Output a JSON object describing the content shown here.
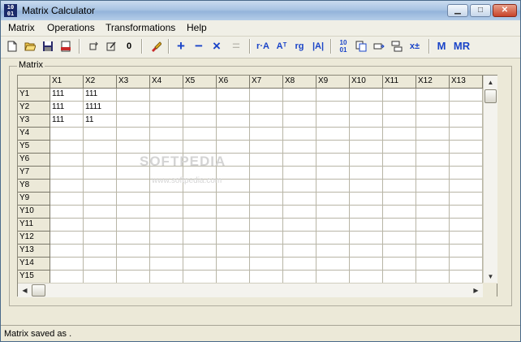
{
  "window": {
    "title": "Matrix Calculator",
    "app_icon_text": "10 01"
  },
  "menu": {
    "items": [
      "Matrix",
      "Operations",
      "Transformations",
      "Help"
    ]
  },
  "toolbar": {
    "groups": [
      [
        "new-file-icon",
        "open-folder-icon",
        "save-icon",
        "export-html-icon"
      ],
      [
        "rotate-icon",
        "edit-icon",
        "zero-icon"
      ],
      [
        "clear-brush-icon"
      ],
      [
        "plus-icon",
        "minus-icon",
        "multiply-icon",
        "equals-icon"
      ],
      [
        "row-op-icon",
        "transpose-icon",
        "rank-icon",
        "determinant-icon"
      ],
      [
        "binary-icon",
        "copy-icon",
        "move-icon",
        "swap-icon",
        "plus-minus-icon"
      ],
      [
        "m-icon",
        "mr-icon"
      ]
    ],
    "labels": {
      "zero": "0",
      "plus": "+",
      "minus": "−",
      "multiply": "×",
      "equals": "=",
      "row_op": "r·A",
      "transpose": "Aᵀ",
      "rank": "rg",
      "determinant": "|A|",
      "binary": "10\n01",
      "plus_minus": "x±",
      "m": "M",
      "mr": "MR"
    }
  },
  "matrix": {
    "group_label": "Matrix",
    "column_headers": [
      "X1",
      "X2",
      "X3",
      "X4",
      "X5",
      "X6",
      "X7",
      "X8",
      "X9",
      "X10",
      "X11",
      "X12",
      "X13"
    ],
    "row_headers": [
      "Y1",
      "Y2",
      "Y3",
      "Y4",
      "Y5",
      "Y6",
      "Y7",
      "Y8",
      "Y9",
      "Y10",
      "Y11",
      "Y12",
      "Y13",
      "Y14",
      "Y15"
    ],
    "cells": [
      [
        "111",
        "111",
        "",
        "",
        "",
        "",
        "",
        "",
        "",
        "",
        "",
        "",
        ""
      ],
      [
        "111",
        "1111",
        "",
        "",
        "",
        "",
        "",
        "",
        "",
        "",
        "",
        "",
        ""
      ],
      [
        "111",
        "11",
        "",
        "",
        "",
        "",
        "",
        "",
        "",
        "",
        "",
        "",
        ""
      ]
    ]
  },
  "watermark": {
    "text": "SOFTPEDIA",
    "sub": "www.softpedia.com"
  },
  "status": {
    "text": "Matrix saved as ."
  },
  "colors": {
    "accent": "#1a44c8",
    "title_bg": "#a9c4e3",
    "close_btn": "#c8432a"
  }
}
